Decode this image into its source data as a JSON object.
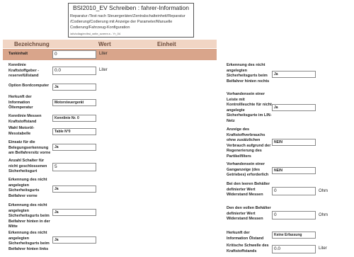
{
  "title": {
    "main": "BSI2010_EV Schreiben : fahrer-Information",
    "description": "Reparatur /Test nach Steuergeräten/Zentralschalteinheit/Reparatur /Codierung/Codierung mit Anzeige der Parameter/Manuelle Codierung/Fahrzeug-Konfiguration",
    "id": "/afx/cdiag/en/bsi_write_screen.s - Yr_04"
  },
  "header": {
    "bezeichnung": "Bezeichnung",
    "wert": "Wert",
    "einheit": "Einheit"
  },
  "left": [
    {
      "label": "Tankinhalt",
      "value": "0",
      "unit": "Liter"
    },
    {
      "label": "Kennlinie Kraftstoffgeber - reservefüllstand",
      "value": "0.0",
      "unit": "Liter"
    },
    {
      "label": "Option Bordcomputer",
      "value": "Ja"
    },
    {
      "label": "Herkunft der Information Öltemperatur",
      "value": "Motorsteuergerät"
    },
    {
      "label": "Kennlinie Messen Kraftstoffstand",
      "value": "Kennlinie Nr. 0"
    },
    {
      "label": "Wahl Motoröl-Messtabelle",
      "value": "Table N°0"
    },
    {
      "label": "Einsatz für die Belegungserkennung am Beifahrersitz vorne",
      "value": "Ja"
    },
    {
      "label": "Anzahl Schalter für nicht geschlossenen Sicherheitsgurt",
      "value": "5"
    },
    {
      "label": "Erkennung des nicht angelegten Sicherheitsgurts Beifahrer vorne",
      "value": "Ja"
    },
    {
      "label": "Erkennung des nicht angelegten Sicherheitsgurts beim Beifahrer hinten in der Mitte",
      "value": "Ja"
    },
    {
      "label": "Erkennung des nicht angelegten Sicherheitsgurts beim Beifahrer hinten links",
      "value": "Ja"
    }
  ],
  "right": [
    {
      "label": "Erkennung des nicht angelegten Sicherheitsgurts beim Beifahrer hinten rechts",
      "value": "Ja"
    },
    {
      "label": "Vorhandensein einer Leiste mit Kontrollleuchte für nicht angelegte Sicherheitsgurte im LIN-Netz",
      "value": "Ja"
    },
    {
      "label": "Anzeige des Kraftstoffverbrauchs ohne zusätzlichen Verbrauch aufgrund der Regenerierung des Partikelfilters",
      "value": "NEIN"
    },
    {
      "label": "Vorhandensein einer Ganganzeige (des Getriebes) erforderlich",
      "value": "NEIN"
    },
    {
      "label": "Bei den leeren Behälter definierter Wert Widerstand Messen",
      "value": "0",
      "unit": "Ohm"
    },
    {
      "label": "Den den vollen Behälter definierter Wert Widerstand Messen",
      "value": "0",
      "unit": "Ohm"
    },
    {
      "label": "Herkunft der Information Ölstand",
      "value": "Keine Erfassung"
    },
    {
      "label": "Kritische Schwelle des Kraftstoffstands",
      "value": "0.0",
      "unit": "Liter"
    }
  ]
}
